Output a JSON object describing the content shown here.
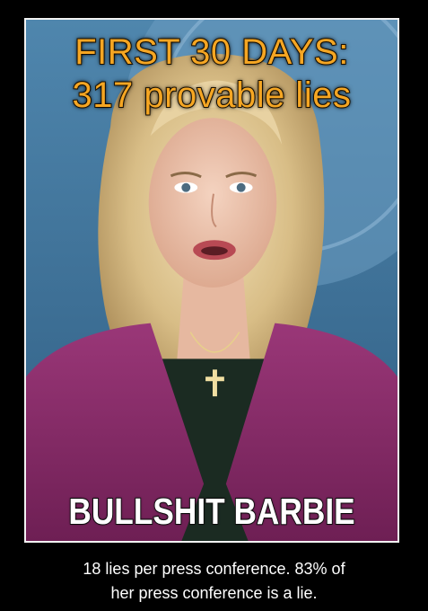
{
  "headline": {
    "line1": "FIRST 30 DAYS:",
    "line2": "317 provable lies"
  },
  "bottom_title": "BULLSHIT BARBIE",
  "caption": {
    "line1": "18 lies per press conference. 83% of",
    "line2": "her press conference is a lie."
  },
  "colors": {
    "headline": "#f5a623",
    "background": "#000000",
    "blazer": "#8c2f6c",
    "seal_blue": "#5b8fb5"
  }
}
